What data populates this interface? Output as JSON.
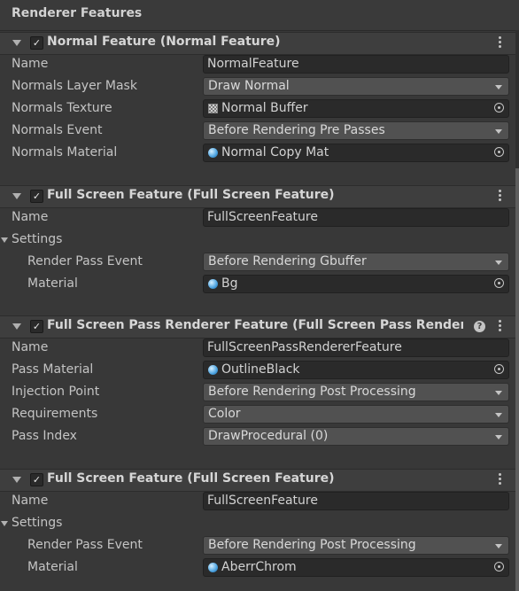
{
  "panel": {
    "title": "Renderer Features"
  },
  "features": [
    {
      "title": "Normal Feature (Normal Feature)",
      "name_label": "Name",
      "name_value": "NormalFeature",
      "rows": [
        {
          "label": "Normals Layer Mask",
          "value": "Draw Normal"
        },
        {
          "label": "Normals Texture",
          "value": "Normal Buffer",
          "icon": "texture-icon"
        },
        {
          "label": "Normals Event",
          "value": "Before Rendering Pre Passes"
        },
        {
          "label": "Normals Material",
          "value": "Normal Copy Mat",
          "icon": "material-icon"
        }
      ]
    },
    {
      "title": "Full Screen Feature (Full Screen Feature)",
      "name_label": "Name",
      "name_value": "FullScreenFeature",
      "settings_label": "Settings",
      "rows": [
        {
          "label": "Render Pass Event",
          "value": "Before Rendering Gbuffer"
        },
        {
          "label": "Material",
          "value": "Bg",
          "icon": "material-icon"
        }
      ]
    },
    {
      "title": "Full Screen Pass Renderer Feature (Full Screen Pass Renderer F",
      "help": "?",
      "name_label": "Name",
      "name_value": "FullScreenPassRendererFeature",
      "rows": [
        {
          "label": "Pass Material",
          "value": "OutlineBlack",
          "icon": "material-icon"
        },
        {
          "label": "Injection Point",
          "value": "Before Rendering Post Processing"
        },
        {
          "label": "Requirements",
          "value": "Color"
        },
        {
          "label": "Pass Index",
          "value": "DrawProcedural (0)"
        }
      ]
    },
    {
      "title": "Full Screen Feature (Full Screen Feature)",
      "name_label": "Name",
      "name_value": "FullScreenFeature",
      "settings_label": "Settings",
      "rows": [
        {
          "label": "Render Pass Event",
          "value": "Before Rendering Post Processing"
        },
        {
          "label": "Material",
          "value": "AberrChrom",
          "icon": "material-icon"
        }
      ]
    }
  ],
  "checkmark": "✓"
}
